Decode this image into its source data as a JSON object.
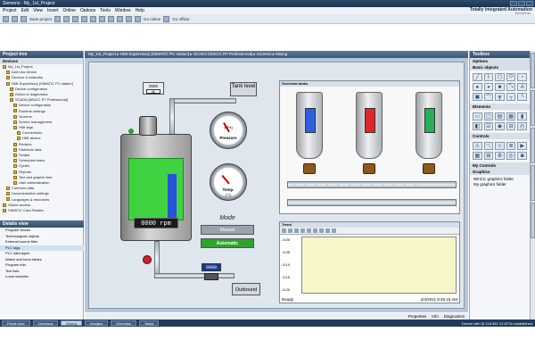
{
  "window": {
    "title": "Siemens  -  My_1st_Project"
  },
  "brand": {
    "line1": "Totally Integrated Automation",
    "line2": "PORTAL"
  },
  "menu": [
    "Project",
    "Edit",
    "View",
    "Insert",
    "Online",
    "Options",
    "Tools",
    "Window",
    "Help"
  ],
  "toolbar": {
    "save_label": "Save project",
    "go_online": "Go online",
    "go_offline": "Go offline"
  },
  "left_pane": {
    "header": "Project tree",
    "subheader": "Devices",
    "items": [
      "My_1st_Project",
      "Add new device",
      "Devices & networks",
      "HMI-Supervisory [SIMATIC PC station]",
      "Device configuration",
      "Online & diagnostics",
      "SCADA [WinCC RT Professional]",
      "Device configuration",
      "Runtime settings",
      "Screens",
      "Screen management",
      "HMI tags",
      "Connections",
      "HMI alarms",
      "Recipes",
      "Historical data",
      "Scripts",
      "Scheduled tasks",
      "Cycles",
      "Reports",
      "Text and graphic lists",
      "User administration",
      "Common data",
      "Documentation settings",
      "Languages & resources",
      "Online access",
      "SIMATIC Card Reader"
    ]
  },
  "details": {
    "header": "Details view",
    "items": [
      "Program blocks",
      "Technological objects",
      "External source files",
      "PLC tags",
      "PLC data types",
      "Watch and force tables",
      "Program info",
      "Text lists",
      "Local modules"
    ],
    "selected_index": 3
  },
  "editor": {
    "breadcrumb": "My_1st_Project  ▸  HMI-Supervisory [SIMATIC PC station]  ▸  SCADA [WinCC RT Professional]  ▸  Screens  ▸  Mixing",
    "counter_value": "0000",
    "counter_unit": "l/h",
    "tank_level_label": "Tank level",
    "rpm_display": "0000 rpm",
    "pressure_label": "Pressure",
    "pressure_unit": "[kPa]",
    "temp_label": "Temp.",
    "temp_unit": "[°C]",
    "mode_title": "Mode",
    "manual_label": "Manual",
    "automatic_label": "Automatic",
    "flow_readout": "0000",
    "outbound_label": "Outbound",
    "overview_title": "Overview tanks",
    "tank_colors": [
      "#2f5fe0",
      "#e0262b",
      "#27b05a"
    ],
    "trend": {
      "title": "Trend",
      "yticks": [
        "-5.00",
        "-5.05",
        "-5.10",
        "-5.15",
        "-5.20"
      ],
      "status": "Ready",
      "date": "2/4/2011",
      "time": "8:45:15 AM"
    }
  },
  "right_pane": {
    "header": "Toolbox",
    "options_label": "Options",
    "sections": [
      "Basic objects",
      "Elements",
      "Controls",
      "My Controls",
      "Graphics"
    ],
    "graphics_items": [
      "WinCC graphics folder",
      "My graphics folder"
    ]
  },
  "properties_bar": [
    "Properties",
    "Info",
    "Diagnostics"
  ],
  "taskbar": {
    "portal_view": "Portal view",
    "tabs": [
      "Overview",
      "Mixing",
      "Designs",
      "Overview",
      "Tanks"
    ],
    "active_index": 1,
    "status": "Device with ID 118.687.13 ATSU established"
  }
}
